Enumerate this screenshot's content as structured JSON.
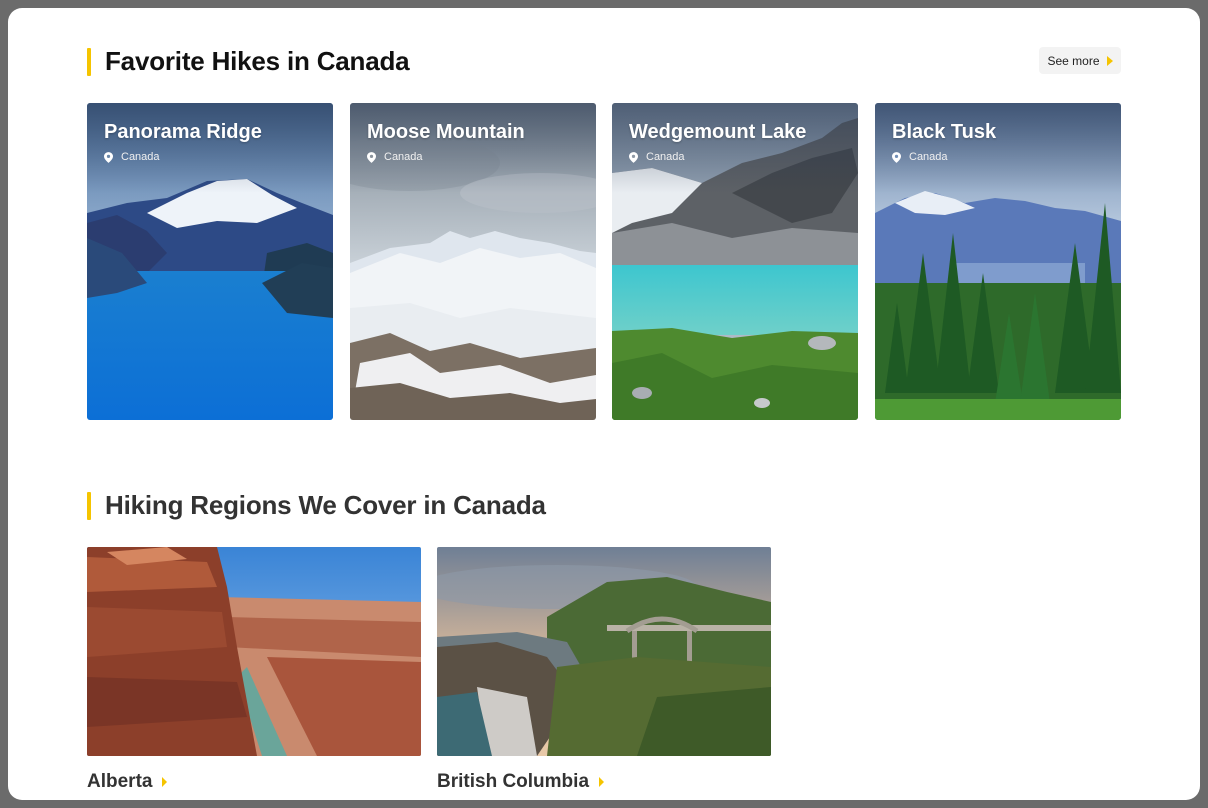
{
  "section_hikes": {
    "title": "Favorite Hikes in Canada",
    "see_more_label": "See more"
  },
  "hikes": [
    {
      "name": "Panorama Ridge",
      "location": "Canada",
      "icon": "location-pin-icon"
    },
    {
      "name": "Moose Mountain",
      "location": "Canada",
      "icon": "location-pin-icon"
    },
    {
      "name": "Wedgemount Lake",
      "location": "Canada",
      "icon": "location-pin-icon"
    },
    {
      "name": "Black Tusk",
      "location": "Canada",
      "icon": "location-pin-icon"
    }
  ],
  "section_regions": {
    "title": "Hiking Regions We Cover in Canada"
  },
  "regions": [
    {
      "name": "Alberta"
    },
    {
      "name": "British Columbia"
    }
  ],
  "colors": {
    "accent": "#f5c400",
    "background_frame": "#6b6b6b",
    "page": "#ffffff"
  }
}
